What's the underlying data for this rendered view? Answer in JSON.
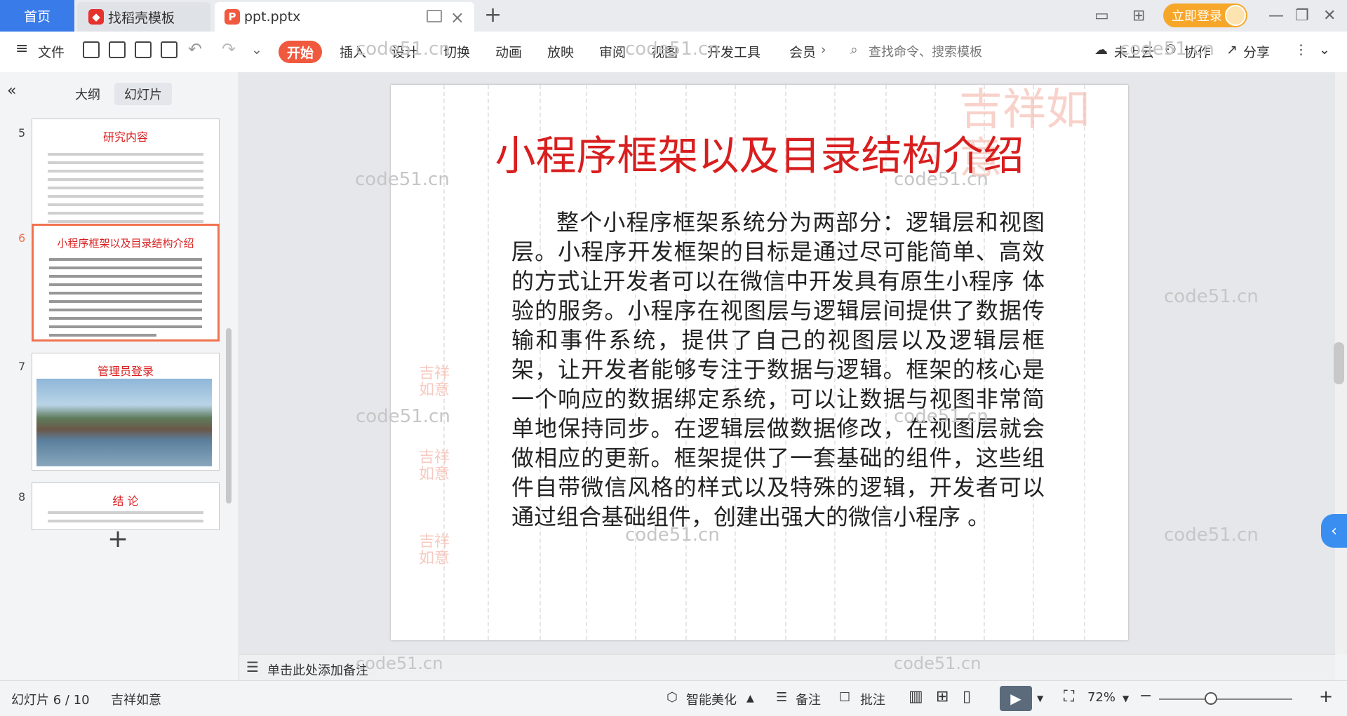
{
  "tabs": {
    "home": "首页",
    "doc1": "找稻壳模板",
    "doc2": "ppt.pptx",
    "add_icon": "plus-icon"
  },
  "topright": {
    "login": "立即登录"
  },
  "ribbon": {
    "file": "文件",
    "menus": [
      "开始",
      "插入",
      "设计",
      "切换",
      "动画",
      "放映",
      "审阅",
      "视图",
      "开发工具",
      "会员"
    ],
    "search_placeholder": "查找命令、搜索模板",
    "cloud": "未上云",
    "collab": "协作",
    "share": "分享"
  },
  "leftpanel": {
    "tab_outline": "大纲",
    "tab_slides": "幻灯片",
    "thumbs": [
      {
        "num": "5",
        "title": "研究内容"
      },
      {
        "num": "6",
        "title": "小程序框架以及目录结构介绍"
      },
      {
        "num": "7",
        "title": "管理员登录"
      },
      {
        "num": "8",
        "title": "结  论"
      }
    ]
  },
  "slide": {
    "title": "小程序框架以及目录结构介绍",
    "body": "整个小程序框架系统分为两部分：逻辑层和视图层。小程序开发框架的目标是通过尽可能简单、高效的方式让开发者可以在微信中开发具有原生小程序 体验的服务。小程序在视图层与逻辑层间提供了数据传输和事件系统，提供了自己的视图层以及逻辑层框架，让开发者能够专注于数据与逻辑。框架的核心是一个响应的数据绑定系统，可以让数据与视图非常简单地保持同步。在逻辑层做数据修改，在视图层就会做相应的更新。框架提供了一套基础的组件，这些组件自带微信风格的样式以及特殊的逻辑，开发者可以通过组合基础组件，创建出强大的微信小程序 。",
    "seal_text": "吉祥如意"
  },
  "watermark": "code51.cn",
  "notes": {
    "placeholder": "单击此处添加备注"
  },
  "status": {
    "slide_count": "幻灯片 6 / 10",
    "theme": "吉祥如意",
    "beautify": "智能美化",
    "notes": "备注",
    "comment": "批注",
    "zoom": "72%"
  },
  "colors": {
    "accent": "#f0593e",
    "title_red": "#d81e1e",
    "home_blue": "#3a7bea",
    "login_orange": "#f6a72a"
  }
}
